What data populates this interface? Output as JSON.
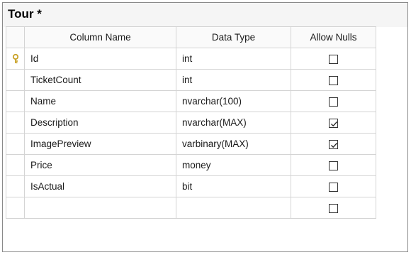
{
  "title": "Tour *",
  "headers": {
    "column_name": "Column Name",
    "data_type": "Data Type",
    "allow_nulls": "Allow Nulls"
  },
  "rows": [
    {
      "name": "Id",
      "type": "int",
      "allow_nulls": false,
      "primary_key": true
    },
    {
      "name": "TicketCount",
      "type": "int",
      "allow_nulls": false,
      "primary_key": false
    },
    {
      "name": "Name",
      "type": "nvarchar(100)",
      "allow_nulls": false,
      "primary_key": false
    },
    {
      "name": "Description",
      "type": "nvarchar(MAX)",
      "allow_nulls": true,
      "primary_key": false
    },
    {
      "name": "ImagePreview",
      "type": "varbinary(MAX)",
      "allow_nulls": true,
      "primary_key": false
    },
    {
      "name": "Price",
      "type": "money",
      "allow_nulls": false,
      "primary_key": false
    },
    {
      "name": "IsActual",
      "type": "bit",
      "allow_nulls": false,
      "primary_key": false
    },
    {
      "name": "",
      "type": "",
      "allow_nulls": false,
      "primary_key": false
    }
  ],
  "icons": {
    "primary_key": "key-icon",
    "checkbox_checked": "checkmark-icon"
  },
  "colors": {
    "key": "#c9a227",
    "border": "#d4d4d4",
    "title_bar": "#f5f5f5"
  }
}
